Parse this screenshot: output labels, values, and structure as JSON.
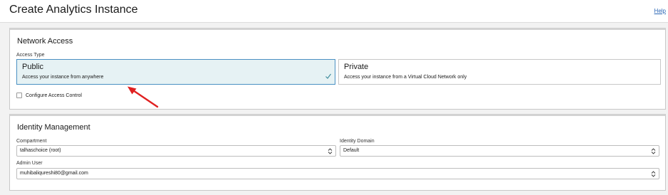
{
  "header": {
    "title": "Create Analytics Instance",
    "help_label": "Help"
  },
  "network_access": {
    "section_title": "Network Access",
    "access_type_label": "Access Type",
    "options": [
      {
        "title": "Public",
        "description": "Access your instance from anywhere",
        "selected": true
      },
      {
        "title": "Private",
        "description": "Access your instance from a Virtual Cloud Network only",
        "selected": false
      }
    ],
    "access_control_label": "Configure Access Control",
    "access_control_checked": false
  },
  "identity_management": {
    "section_title": "Identity Management",
    "compartment_label": "Compartment",
    "compartment_value": "talhaschoice (root)",
    "identity_domain_label": "Identity Domain",
    "identity_domain_value": "Default",
    "admin_user_label": "Admin User",
    "admin_user_value": "muhibaliqureshi80@gmail.com"
  },
  "colors": {
    "accent": "#4a90c2",
    "selected_bg": "#e6f2f4",
    "check": "#3a8a9a",
    "annotation_arrow": "#e02020",
    "link": "#2864b4"
  },
  "icons": {
    "selected_check": "check-icon",
    "select_arrows": "chevron-up-down-icon",
    "annotation": "red-arrow-annotation"
  }
}
